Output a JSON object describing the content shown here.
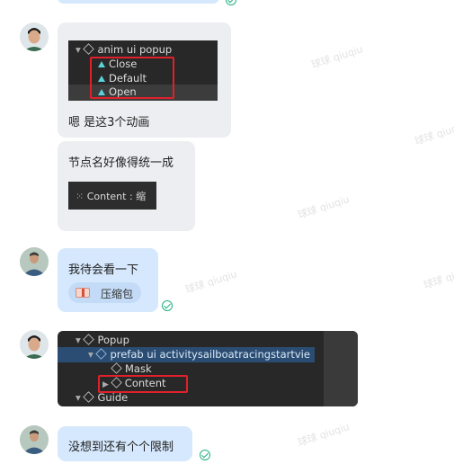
{
  "messages": {
    "m1_caption": "嗯 是这3个动画",
    "m2_text": "节点名好像得统一成",
    "m3_text": "我待会看一下",
    "m3_attachment": "压缩包",
    "m5_text": "没想到还有个个限制"
  },
  "shot1": {
    "parent": "anim ui popup",
    "items": [
      "Close",
      "Default",
      "Open"
    ]
  },
  "shot2": {
    "content_label": "Content : 缩"
  },
  "shot3": {
    "rows": [
      "Popup",
      "prefab ui activitysailboatracingstartvie",
      "Mask",
      "Content",
      "Guide"
    ]
  },
  "watermark": "球球 qiuqiu",
  "colors": {
    "blue_bubble": "#d6e8fd",
    "grey_bubble": "#eceef1",
    "check": "#22b07d",
    "highlight": "#e0212b"
  }
}
